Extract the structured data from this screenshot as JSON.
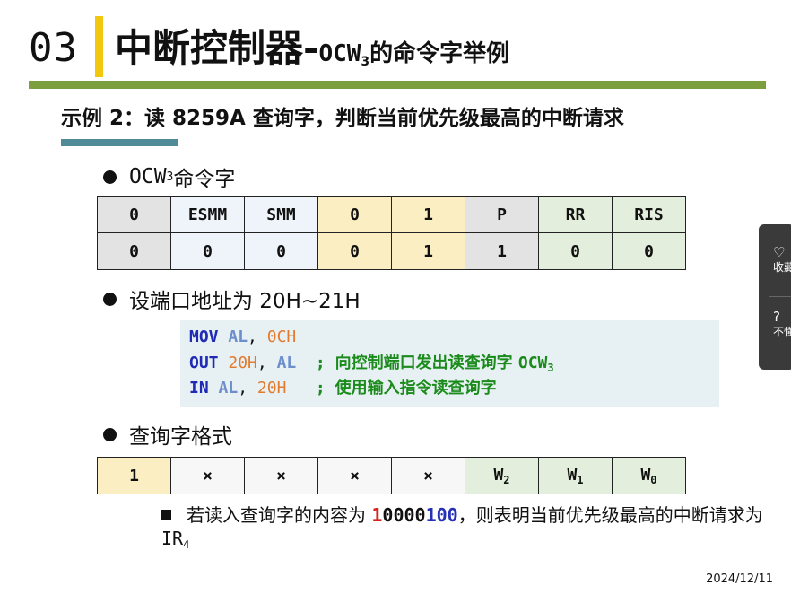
{
  "header": {
    "section_number": "03",
    "title_main": "中断控制器-",
    "title_ocw": "OCW",
    "title_ocw_sub": "3",
    "title_tail": "的命令字举例"
  },
  "subtitle": "示例 2：读 8259A 查询字，判断当前优先级最高的中断请求",
  "ocw3": {
    "label_prefix": "OCW",
    "label_sub": "3",
    "label_suffix": " 命令字",
    "row1": [
      "0",
      "ESMM",
      "SMM",
      "0",
      "1",
      "P",
      "RR",
      "RIS"
    ],
    "row2": [
      "0",
      "0",
      "0",
      "0",
      "1",
      "1",
      "0",
      "0"
    ]
  },
  "port_address": "设端口地址为 20H~21H",
  "code": {
    "line1": {
      "op": "MOV",
      "reg": "AL",
      "sep": ", ",
      "val": "0CH"
    },
    "line2": {
      "op": "OUT",
      "val": "20H",
      "sep": ", ",
      "reg": "AL",
      "pad": "  ; ",
      "comment": "向控制端口发出读查询字 ",
      "comment_tail": "OCW",
      "comment_sub": "3"
    },
    "line3": {
      "op": "IN",
      "reg": "AL",
      "sep": ", ",
      "val": "20H",
      "pad": "   ; ",
      "comment": "使用输入指令读查询字"
    }
  },
  "query_format": {
    "label": "查询字格式",
    "cells": [
      "1",
      "×",
      "×",
      "×",
      "×",
      "W",
      "W",
      "W"
    ],
    "subs": [
      "",
      "",
      "",
      "",
      "",
      "2",
      "1",
      "0"
    ]
  },
  "note": {
    "prefix": "若读入查询字的内容为 ",
    "red": "1",
    "mid": "0000",
    "blue": "100",
    "suffix": "，则表明当前优先级最高的中断请求为 ",
    "ir": "IR",
    "ir_sub": "4"
  },
  "date": "2024/12/11",
  "side_widget": {
    "favorite_label": "收藏",
    "help_label": "不懂",
    "favorite_icon": "heart-icon",
    "help_icon": "question-icon"
  },
  "colors": {
    "accent_bar": "#f2c80f",
    "header_rule": "#7a9f3c",
    "subtitle_bar": "#4e8a97",
    "code_bg": "#e7f1f4"
  }
}
